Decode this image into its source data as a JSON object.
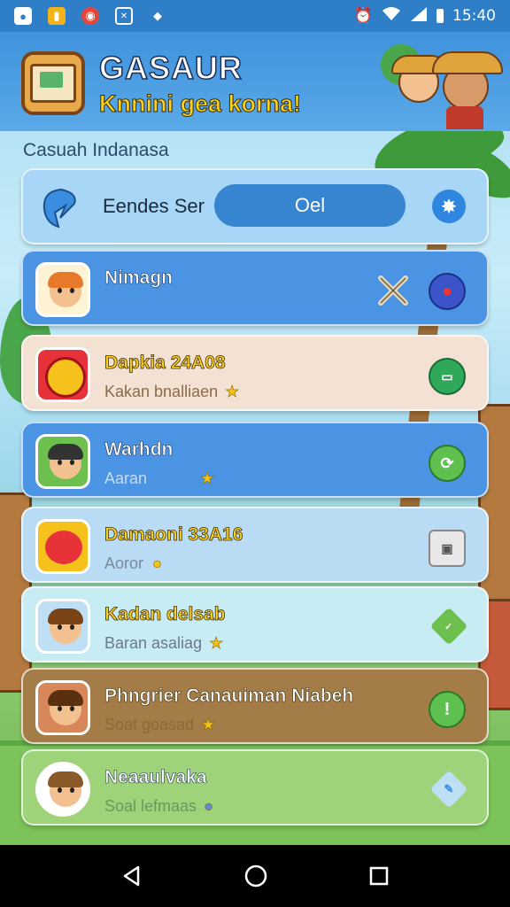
{
  "status_bar": {
    "time": "15:40",
    "icons": [
      "wifi-icon",
      "signal-icon",
      "alarm-icon"
    ]
  },
  "header": {
    "title": "GASAUR",
    "subtitle": "Knnini gea korna!"
  },
  "section_label": "Casuah Indanasa",
  "toggle_row": {
    "label": "Eendes Ser",
    "toggle_value": "Oel"
  },
  "items": [
    {
      "title": "Nimagn",
      "subtitle": "",
      "action_icon": "chat-icon"
    },
    {
      "title": "Dapkia 24A08",
      "subtitle": "Kakan bnalliaen",
      "action_icon": "window-icon"
    },
    {
      "title": "Warhdn",
      "subtitle": "Aaran",
      "action_icon": "refresh-icon"
    },
    {
      "title": "Damaoni 33A16",
      "subtitle": "Aoror",
      "action_icon": "screen-icon"
    },
    {
      "title": "Kadan delsab",
      "subtitle": "Baran asaliag",
      "action_icon": "layers-icon"
    },
    {
      "title": "Phngrier Canauiman Niabeh",
      "subtitle": "Soat goasad",
      "action_icon": "alert-icon"
    },
    {
      "title": "Neaaulvaka",
      "subtitle": "Soal lefmaas",
      "action_icon": "pencil-icon"
    }
  ],
  "colors": {
    "header_blue": "#3f92dc",
    "accent_yellow": "#ffd21c"
  }
}
